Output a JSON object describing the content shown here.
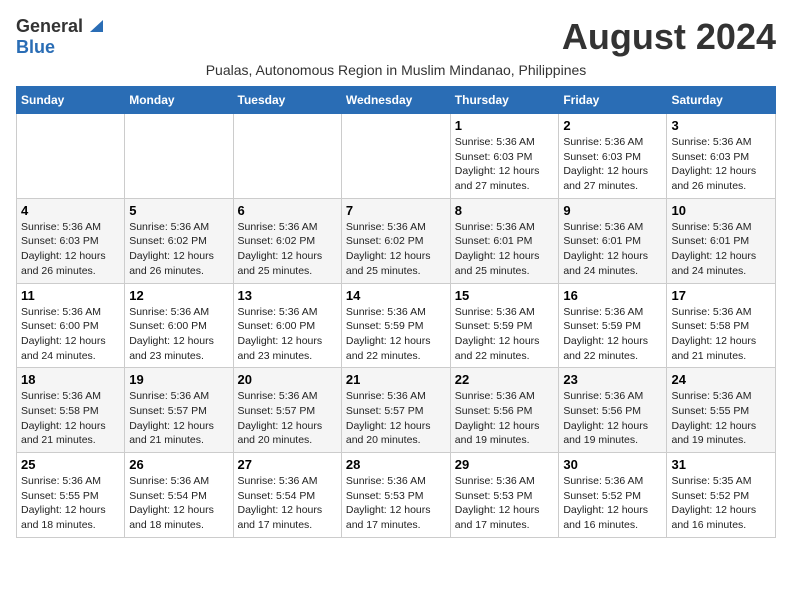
{
  "logo": {
    "line1": "General",
    "line2": "Blue"
  },
  "title": "August 2024",
  "subtitle": "Pualas, Autonomous Region in Muslim Mindanao, Philippines",
  "days_of_week": [
    "Sunday",
    "Monday",
    "Tuesday",
    "Wednesday",
    "Thursday",
    "Friday",
    "Saturday"
  ],
  "weeks": [
    [
      {
        "num": "",
        "info": ""
      },
      {
        "num": "",
        "info": ""
      },
      {
        "num": "",
        "info": ""
      },
      {
        "num": "",
        "info": ""
      },
      {
        "num": "1",
        "info": "Sunrise: 5:36 AM\nSunset: 6:03 PM\nDaylight: 12 hours and 27 minutes."
      },
      {
        "num": "2",
        "info": "Sunrise: 5:36 AM\nSunset: 6:03 PM\nDaylight: 12 hours and 27 minutes."
      },
      {
        "num": "3",
        "info": "Sunrise: 5:36 AM\nSunset: 6:03 PM\nDaylight: 12 hours and 26 minutes."
      }
    ],
    [
      {
        "num": "4",
        "info": "Sunrise: 5:36 AM\nSunset: 6:03 PM\nDaylight: 12 hours and 26 minutes."
      },
      {
        "num": "5",
        "info": "Sunrise: 5:36 AM\nSunset: 6:02 PM\nDaylight: 12 hours and 26 minutes."
      },
      {
        "num": "6",
        "info": "Sunrise: 5:36 AM\nSunset: 6:02 PM\nDaylight: 12 hours and 25 minutes."
      },
      {
        "num": "7",
        "info": "Sunrise: 5:36 AM\nSunset: 6:02 PM\nDaylight: 12 hours and 25 minutes."
      },
      {
        "num": "8",
        "info": "Sunrise: 5:36 AM\nSunset: 6:01 PM\nDaylight: 12 hours and 25 minutes."
      },
      {
        "num": "9",
        "info": "Sunrise: 5:36 AM\nSunset: 6:01 PM\nDaylight: 12 hours and 24 minutes."
      },
      {
        "num": "10",
        "info": "Sunrise: 5:36 AM\nSunset: 6:01 PM\nDaylight: 12 hours and 24 minutes."
      }
    ],
    [
      {
        "num": "11",
        "info": "Sunrise: 5:36 AM\nSunset: 6:00 PM\nDaylight: 12 hours and 24 minutes."
      },
      {
        "num": "12",
        "info": "Sunrise: 5:36 AM\nSunset: 6:00 PM\nDaylight: 12 hours and 23 minutes."
      },
      {
        "num": "13",
        "info": "Sunrise: 5:36 AM\nSunset: 6:00 PM\nDaylight: 12 hours and 23 minutes."
      },
      {
        "num": "14",
        "info": "Sunrise: 5:36 AM\nSunset: 5:59 PM\nDaylight: 12 hours and 22 minutes."
      },
      {
        "num": "15",
        "info": "Sunrise: 5:36 AM\nSunset: 5:59 PM\nDaylight: 12 hours and 22 minutes."
      },
      {
        "num": "16",
        "info": "Sunrise: 5:36 AM\nSunset: 5:59 PM\nDaylight: 12 hours and 22 minutes."
      },
      {
        "num": "17",
        "info": "Sunrise: 5:36 AM\nSunset: 5:58 PM\nDaylight: 12 hours and 21 minutes."
      }
    ],
    [
      {
        "num": "18",
        "info": "Sunrise: 5:36 AM\nSunset: 5:58 PM\nDaylight: 12 hours and 21 minutes."
      },
      {
        "num": "19",
        "info": "Sunrise: 5:36 AM\nSunset: 5:57 PM\nDaylight: 12 hours and 21 minutes."
      },
      {
        "num": "20",
        "info": "Sunrise: 5:36 AM\nSunset: 5:57 PM\nDaylight: 12 hours and 20 minutes."
      },
      {
        "num": "21",
        "info": "Sunrise: 5:36 AM\nSunset: 5:57 PM\nDaylight: 12 hours and 20 minutes."
      },
      {
        "num": "22",
        "info": "Sunrise: 5:36 AM\nSunset: 5:56 PM\nDaylight: 12 hours and 19 minutes."
      },
      {
        "num": "23",
        "info": "Sunrise: 5:36 AM\nSunset: 5:56 PM\nDaylight: 12 hours and 19 minutes."
      },
      {
        "num": "24",
        "info": "Sunrise: 5:36 AM\nSunset: 5:55 PM\nDaylight: 12 hours and 19 minutes."
      }
    ],
    [
      {
        "num": "25",
        "info": "Sunrise: 5:36 AM\nSunset: 5:55 PM\nDaylight: 12 hours and 18 minutes."
      },
      {
        "num": "26",
        "info": "Sunrise: 5:36 AM\nSunset: 5:54 PM\nDaylight: 12 hours and 18 minutes."
      },
      {
        "num": "27",
        "info": "Sunrise: 5:36 AM\nSunset: 5:54 PM\nDaylight: 12 hours and 17 minutes."
      },
      {
        "num": "28",
        "info": "Sunrise: 5:36 AM\nSunset: 5:53 PM\nDaylight: 12 hours and 17 minutes."
      },
      {
        "num": "29",
        "info": "Sunrise: 5:36 AM\nSunset: 5:53 PM\nDaylight: 12 hours and 17 minutes."
      },
      {
        "num": "30",
        "info": "Sunrise: 5:36 AM\nSunset: 5:52 PM\nDaylight: 12 hours and 16 minutes."
      },
      {
        "num": "31",
        "info": "Sunrise: 5:35 AM\nSunset: 5:52 PM\nDaylight: 12 hours and 16 minutes."
      }
    ]
  ]
}
